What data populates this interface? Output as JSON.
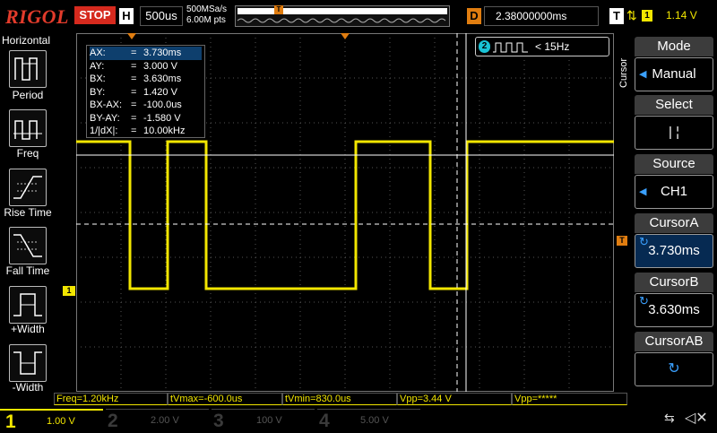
{
  "top": {
    "brand": "RIGOL",
    "run_state": "STOP",
    "h_badge": "H",
    "timebase": "500us",
    "sample_rate": "500MSa/s",
    "mem_depth": "6.00M pts",
    "mem_trigger_badge": "T",
    "delay_badge": "D",
    "delay_value": "2.38000000ms",
    "trigger_badge": "T",
    "trigger_edge_icon": "rising-falling-edge-icon",
    "trigger_channel": "1",
    "trigger_level": "1.14 V"
  },
  "left_menu": {
    "title": "Horizontal",
    "items": [
      {
        "label": "Period",
        "icon": "period-icon"
      },
      {
        "label": "Freq",
        "icon": "frequency-icon"
      },
      {
        "label": "Rise Time",
        "icon": "rise-time-icon"
      },
      {
        "label": "Fall Time",
        "icon": "fall-time-icon"
      },
      {
        "label": "+Width",
        "icon": "positive-width-icon"
      },
      {
        "label": "-Width",
        "icon": "negative-width-icon"
      }
    ]
  },
  "cursor_readout": {
    "rows": [
      {
        "k": "AX:",
        "v": "3.730ms"
      },
      {
        "k": "AY:",
        "v": "3.000 V"
      },
      {
        "k": "BX:",
        "v": "3.630ms"
      },
      {
        "k": "BY:",
        "v": "1.420 V"
      },
      {
        "k": "BX-AX:",
        "v": "-100.0us"
      },
      {
        "k": "BY-AY:",
        "v": "-1.580 V"
      },
      {
        "k": "1/|dX|:",
        "v": "10.00kHz"
      }
    ],
    "eq": "="
  },
  "ch2_freq": {
    "channel": "2",
    "value": "< 15Hz"
  },
  "grid_markers": {
    "ch1_marker": "1",
    "trig_marker": "T"
  },
  "right_menu": {
    "side_label": "Cursor",
    "mode_label": "Mode",
    "mode_value": "Manual",
    "select_label": "Select",
    "select_value": "| ¦",
    "source_label": "Source",
    "source_value": "CH1",
    "cursora_label": "CursorA",
    "cursora_value": "3.730ms",
    "cursorb_label": "CursorB",
    "cursorb_value": "3.630ms",
    "cursorab_label": "CursorAB"
  },
  "measurements": [
    "Freq=1.20kHz",
    "tVmax=-600.0us",
    "tVmin=830.0us",
    "Vpp=3.44 V",
    "Vpp=*****"
  ],
  "channels": [
    {
      "num": "1",
      "scale": "1.00 V",
      "color": "#f2e600"
    },
    {
      "num": "2",
      "scale": "2.00 V",
      "color": "#19c3d6"
    },
    {
      "num": "3",
      "scale": "100 V",
      "color": "#d946c8"
    },
    {
      "num": "4",
      "scale": "5.00 V",
      "color": "#2b6ff0"
    }
  ],
  "status_icons": {
    "usb": "usb-icon",
    "sound": "speaker-muted-icon"
  },
  "colors": {
    "ch1": "#f2e600",
    "brand_red": "#e23b2b",
    "trigger_orange": "#e07d10",
    "menu_highlight": "#062a52"
  }
}
